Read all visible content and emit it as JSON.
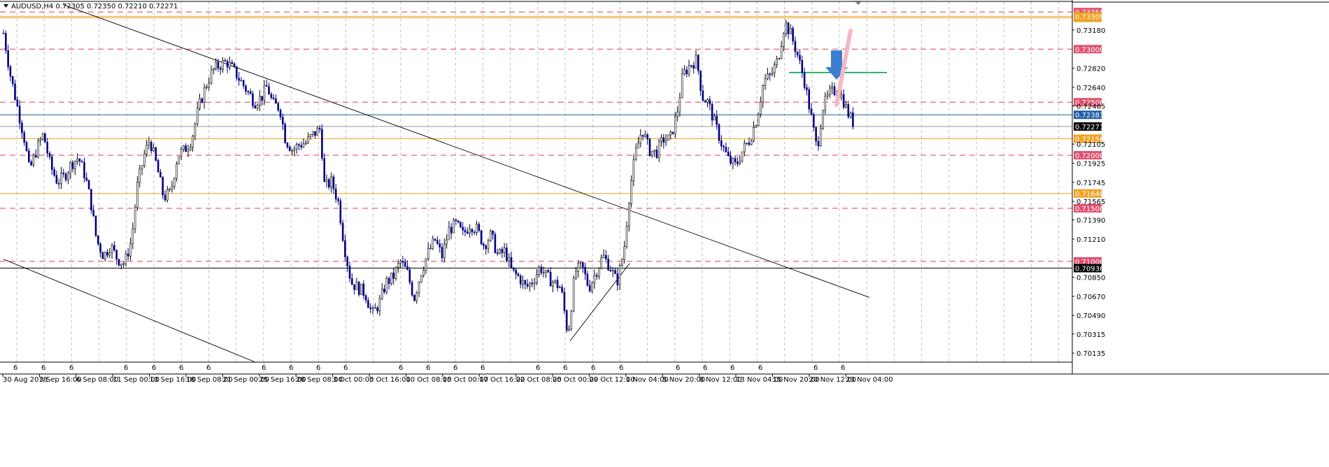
{
  "window": {
    "header_text": "AUDUSD,H4  0.72305 0.72350 0.72210 0.72271"
  },
  "colors": {
    "background": "#ffffff",
    "grid": "#c0c0c0",
    "bull_candle": "#000000",
    "bear_candle": "#000080",
    "dashed_level": "#e0506e",
    "orange_level": "#f0a020",
    "blue_level": "#1f5fa8",
    "green_line": "#00a040",
    "price_tag_black": "#000000",
    "arrow_blue": "#3a7fd0",
    "arrow_pink": "#f5b8c2"
  },
  "icons": {
    "header_dropdown": "triangle-down-icon",
    "scroll_marker": "triangle-down-icon",
    "down_arrow_annotation": "down-arrow-icon",
    "up_arrow_annotation": "diagonal-arrow-icon"
  },
  "chart_data": {
    "type": "candlestick",
    "symbol": "AUDUSD",
    "timeframe": "H4",
    "ohlc_last": {
      "open": 0.72305,
      "high": 0.7235,
      "low": 0.7221,
      "close": 0.72271
    },
    "current_price": 0.72271,
    "ylim": [
      0.7005,
      0.7345
    ],
    "y_tick_labels": [
      "0.73180",
      "0.72820",
      "0.72640",
      "0.72465",
      "0.72105",
      "0.71925",
      "0.71745",
      "0.71565",
      "0.71390",
      "0.71210",
      "0.70850",
      "0.70670",
      "0.70490",
      "0.70315",
      "0.70135"
    ],
    "x_tick_labels": [
      "30 Aug 2018",
      "3 Sep 16:00",
      "6 Sep 08:00",
      "11 Sep 00:00",
      "13 Sep 16:00",
      "18 Sep 08:00",
      "21 Sep 00:00",
      "25 Sep 16:00",
      "28 Sep 08:00",
      "3 Oct 00:00",
      "5 Oct 16:00",
      "10 Oct 08:00",
      "15 Oct 00:00",
      "17 Oct 16:00",
      "22 Oct 08:00",
      "25 Oct 00:00",
      "29 Oct 12:00",
      "1 Nov 04:00",
      "5 Nov 20:00",
      "8 Nov 12:00",
      "13 Nov 04:00",
      "15 Nov 20:00",
      "20 Nov 12:00",
      "23 Nov 04:00"
    ],
    "sub_marker_label": "6",
    "horizontal_levels": [
      {
        "price": 0.7335,
        "label": "0.73350",
        "style": "dashed-red"
      },
      {
        "price": 0.73295,
        "label": "0.73295",
        "style": "orange"
      },
      {
        "price": 0.73309,
        "label": "0.73309",
        "style": "orange"
      },
      {
        "price": 0.73,
        "label": "0.73000",
        "style": "dashed-red"
      },
      {
        "price": 0.725,
        "label": "0.72500",
        "style": "dashed-red"
      },
      {
        "price": 0.72381,
        "label": "0.72381",
        "style": "blue"
      },
      {
        "price": 0.72271,
        "label": "0.72271",
        "style": "current"
      },
      {
        "price": 0.72156,
        "label": "0.72156",
        "style": "orange"
      },
      {
        "price": 0.72,
        "label": "0.72000",
        "style": "dashed-red"
      },
      {
        "price": 0.7164,
        "label": "0.71640",
        "style": "orange"
      },
      {
        "price": 0.715,
        "label": "0.71500",
        "style": "dashed-red"
      },
      {
        "price": 0.71,
        "label": "0.71000",
        "style": "dashed-red"
      },
      {
        "price": 0.70936,
        "label": "0.70936",
        "style": "black"
      }
    ],
    "trendlines": [
      {
        "name": "upper-descending-trendline",
        "from": [
          90,
          0.7342
        ],
        "to": [
          1243,
          0.7066
        ]
      },
      {
        "name": "lower-descending-channel",
        "from": [
          5,
          0.7102
        ],
        "to": [
          365,
          0.7005
        ]
      },
      {
        "name": "rising-support-trendline",
        "from": [
          815,
          0.7025
        ],
        "to": [
          900,
          0.7098
        ]
      },
      {
        "name": "resistance-green-line",
        "from": [
          1128,
          0.7278
        ],
        "to": [
          1268,
          0.7278
        ]
      }
    ],
    "price_path": [
      [
        5,
        0.7315
      ],
      [
        15,
        0.7275
      ],
      [
        25,
        0.7245
      ],
      [
        35,
        0.7215
      ],
      [
        42,
        0.7185
      ],
      [
        52,
        0.7205
      ],
      [
        62,
        0.722
      ],
      [
        72,
        0.719
      ],
      [
        82,
        0.7175
      ],
      [
        92,
        0.718
      ],
      [
        102,
        0.7192
      ],
      [
        112,
        0.7198
      ],
      [
        122,
        0.718
      ],
      [
        130,
        0.7155
      ],
      [
        138,
        0.712
      ],
      [
        148,
        0.7105
      ],
      [
        158,
        0.7115
      ],
      [
        168,
        0.7102
      ],
      [
        178,
        0.7098
      ],
      [
        188,
        0.712
      ],
      [
        196,
        0.717
      ],
      [
        206,
        0.72
      ],
      [
        214,
        0.7215
      ],
      [
        224,
        0.719
      ],
      [
        234,
        0.716
      ],
      [
        244,
        0.7165
      ],
      [
        254,
        0.72
      ],
      [
        264,
        0.7205
      ],
      [
        274,
        0.7215
      ],
      [
        284,
        0.7245
      ],
      [
        294,
        0.7265
      ],
      [
        304,
        0.728
      ],
      [
        314,
        0.7285
      ],
      [
        324,
        0.7288
      ],
      [
        334,
        0.728
      ],
      [
        344,
        0.727
      ],
      [
        354,
        0.726
      ],
      [
        364,
        0.725
      ],
      [
        374,
        0.7255
      ],
      [
        382,
        0.7265
      ],
      [
        390,
        0.7248
      ],
      [
        400,
        0.7245
      ],
      [
        408,
        0.7215
      ],
      [
        418,
        0.7205
      ],
      [
        428,
        0.721
      ],
      [
        438,
        0.7212
      ],
      [
        448,
        0.722
      ],
      [
        458,
        0.7225
      ],
      [
        464,
        0.717
      ],
      [
        474,
        0.7175
      ],
      [
        484,
        0.7155
      ],
      [
        492,
        0.7115
      ],
      [
        502,
        0.708
      ],
      [
        512,
        0.7075
      ],
      [
        522,
        0.707
      ],
      [
        532,
        0.705
      ],
      [
        542,
        0.706
      ],
      [
        552,
        0.708
      ],
      [
        562,
        0.7085
      ],
      [
        572,
        0.71
      ],
      [
        582,
        0.709
      ],
      [
        592,
        0.7065
      ],
      [
        602,
        0.709
      ],
      [
        612,
        0.7108
      ],
      [
        622,
        0.712
      ],
      [
        632,
        0.7105
      ],
      [
        642,
        0.713
      ],
      [
        652,
        0.7135
      ],
      [
        662,
        0.7125
      ],
      [
        672,
        0.7135
      ],
      [
        682,
        0.713
      ],
      [
        692,
        0.7115
      ],
      [
        702,
        0.7125
      ],
      [
        712,
        0.7105
      ],
      [
        722,
        0.711
      ],
      [
        732,
        0.709
      ],
      [
        742,
        0.7085
      ],
      [
        752,
        0.7075
      ],
      [
        762,
        0.7082
      ],
      [
        772,
        0.7095
      ],
      [
        782,
        0.7085
      ],
      [
        792,
        0.708
      ],
      [
        802,
        0.7075
      ],
      [
        812,
        0.703
      ],
      [
        822,
        0.709
      ],
      [
        832,
        0.7095
      ],
      [
        842,
        0.7075
      ],
      [
        852,
        0.709
      ],
      [
        862,
        0.7105
      ],
      [
        872,
        0.7095
      ],
      [
        882,
        0.708
      ],
      [
        892,
        0.711
      ],
      [
        900,
        0.7165
      ],
      [
        908,
        0.72
      ],
      [
        918,
        0.7225
      ],
      [
        928,
        0.7205
      ],
      [
        938,
        0.7202
      ],
      [
        948,
        0.7215
      ],
      [
        958,
        0.7215
      ],
      [
        968,
        0.724
      ],
      [
        976,
        0.7275
      ],
      [
        986,
        0.7285
      ],
      [
        996,
        0.729
      ],
      [
        1004,
        0.7255
      ],
      [
        1012,
        0.725
      ],
      [
        1022,
        0.723
      ],
      [
        1032,
        0.721
      ],
      [
        1042,
        0.7195
      ],
      [
        1052,
        0.719
      ],
      [
        1062,
        0.7205
      ],
      [
        1072,
        0.7215
      ],
      [
        1082,
        0.7235
      ],
      [
        1092,
        0.727
      ],
      [
        1102,
        0.7275
      ],
      [
        1112,
        0.729
      ],
      [
        1122,
        0.7325
      ],
      [
        1130,
        0.7315
      ],
      [
        1140,
        0.7295
      ],
      [
        1150,
        0.727
      ],
      [
        1160,
        0.7235
      ],
      [
        1168,
        0.7205
      ],
      [
        1176,
        0.7245
      ],
      [
        1186,
        0.7258
      ],
      [
        1196,
        0.7262
      ],
      [
        1204,
        0.7255
      ],
      [
        1212,
        0.724
      ],
      [
        1222,
        0.7228
      ]
    ]
  }
}
